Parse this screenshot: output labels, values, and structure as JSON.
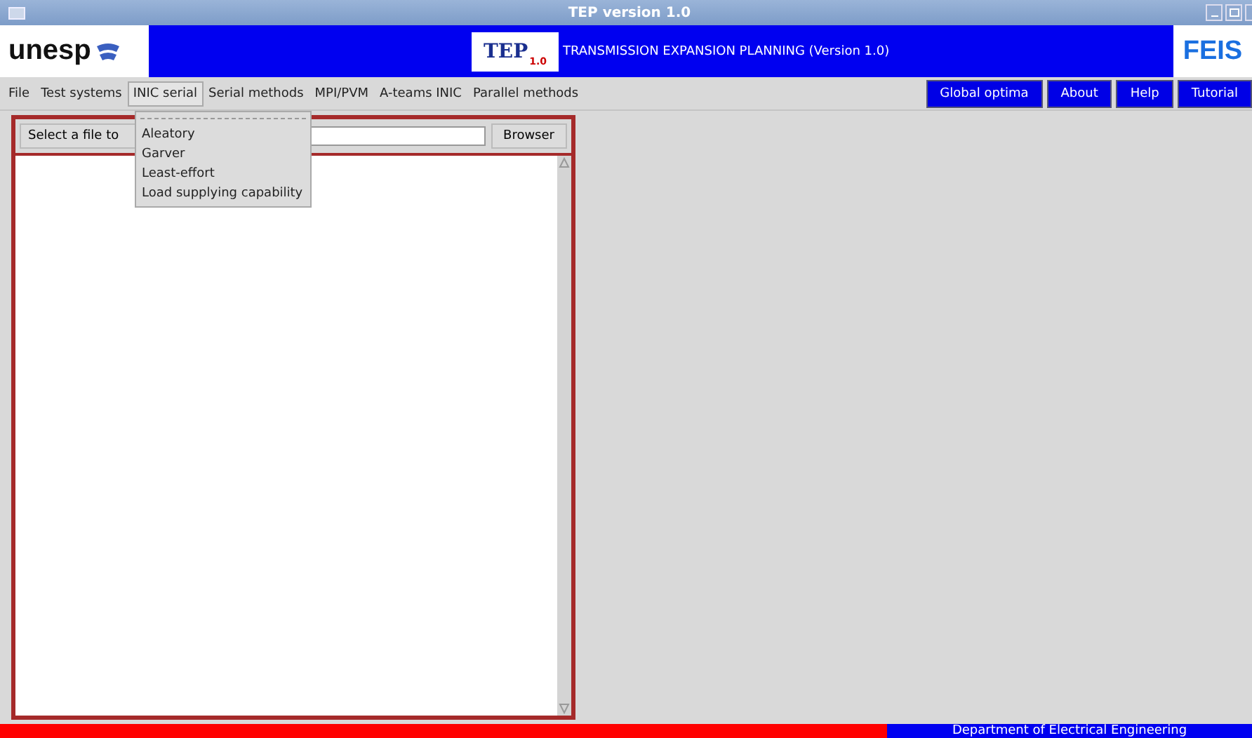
{
  "window": {
    "title": "TEP version 1.0"
  },
  "header": {
    "left_logo": "unesp",
    "center_logo": "TEP",
    "center_logo_version": "1.0",
    "subtitle": "TRANSMISSION EXPANSION PLANNING (Version 1.0)",
    "right_logo": "FEIS"
  },
  "menu": [
    {
      "label": "File",
      "selected": false
    },
    {
      "label": "Test systems",
      "selected": false
    },
    {
      "label": "INIC serial",
      "selected": true
    },
    {
      "label": "Serial methods",
      "selected": false
    },
    {
      "label": "MPI/PVM",
      "selected": false
    },
    {
      "label": "A-teams INIC",
      "selected": false
    },
    {
      "label": "Parallel methods",
      "selected": false
    }
  ],
  "toolbar_buttons": [
    "Global optima",
    "About",
    "Help",
    "Tutorial"
  ],
  "dropdown": {
    "items": [
      "Aleatory",
      "Garver",
      "Least-effort",
      "Load supplying capability"
    ]
  },
  "file_panel": {
    "select_label": "Select a file to",
    "browse_button": "Browser"
  },
  "status_bar": {
    "text": "Department of Electrical  Engineering"
  }
}
